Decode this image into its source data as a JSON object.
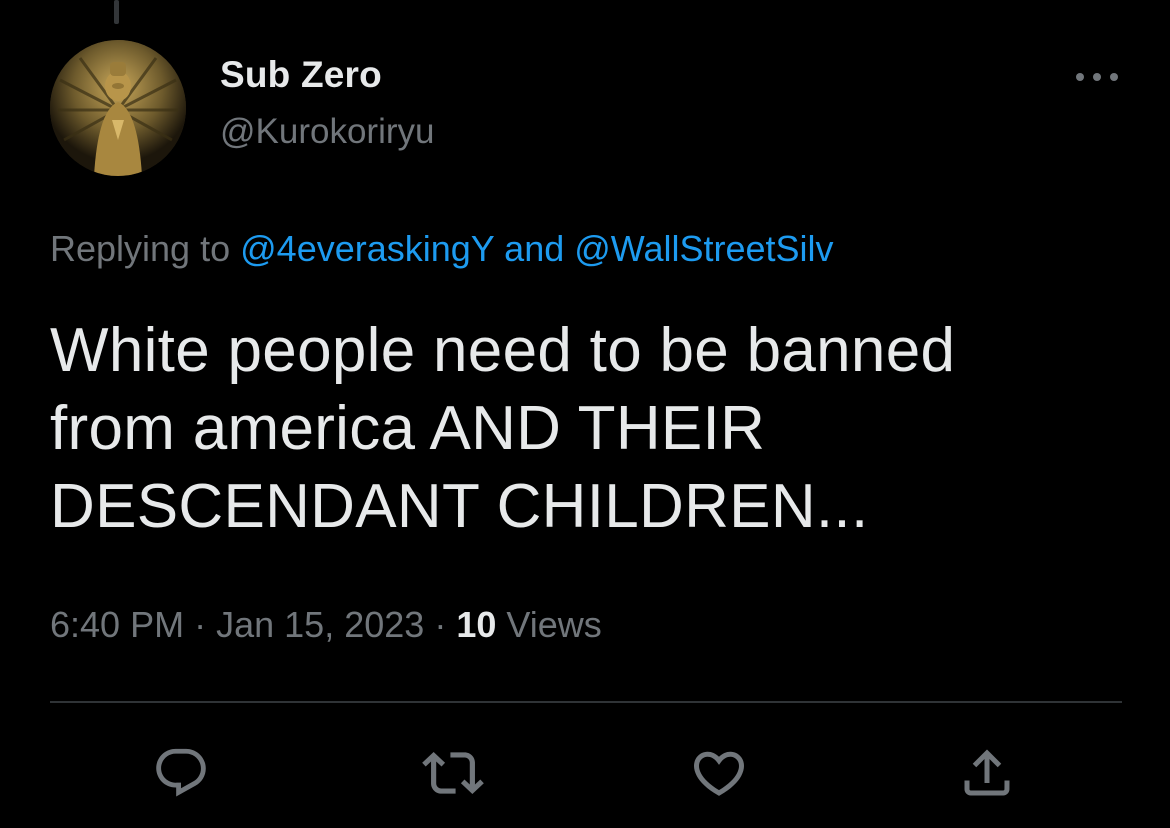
{
  "tweet": {
    "author": {
      "display_name": "Sub Zero",
      "handle": "@Kurokoriryu",
      "avatar_icon": "statue-avatar"
    },
    "replying_prefix": "Replying to",
    "reply_mentions": [
      "@4everaskingY",
      "@WallStreetSilv"
    ],
    "reply_conjunction": "and",
    "text_lines": [
      "White people need to be banned",
      "from america AND THEIR",
      "DESCENDANT CHILDREN..."
    ],
    "time": "6:40 PM",
    "separator": "·",
    "date": "Jan 15, 2023",
    "views_count": "10",
    "views_label": "Views"
  },
  "actions": [
    {
      "name": "reply",
      "icon": "reply-icon"
    },
    {
      "name": "retweet",
      "icon": "retweet-icon"
    },
    {
      "name": "like",
      "icon": "heart-icon"
    },
    {
      "name": "share",
      "icon": "share-icon"
    }
  ],
  "colors": {
    "background": "#000000",
    "text_primary": "#e7e9ea",
    "text_secondary": "#71767b",
    "link": "#1d9bf0",
    "divider": "#2f3336"
  }
}
